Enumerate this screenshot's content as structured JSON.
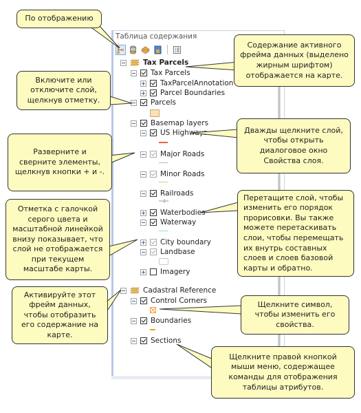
{
  "panel": {
    "title": "Таблица содержания",
    "toolbar": [
      {
        "icon": "list-by-drawing-order-icon",
        "active": true
      },
      {
        "icon": "list-by-source-icon",
        "active": false
      },
      {
        "icon": "list-by-visibility-icon",
        "active": false
      },
      {
        "icon": "list-by-selection-icon",
        "active": false
      },
      {
        "icon": "options-icon",
        "active": false
      }
    ]
  },
  "tree": {
    "tax_parcels_frame": "Tax Parcels",
    "tax_parcels_group": "Tax Parcels",
    "tax_parcel_annotation": "TaxParcelAnnotation",
    "parcel_boundaries": "Parcel Boundaries",
    "parcels": "Parcels",
    "basemap_layers": "Basemap layers",
    "us_highways": "US Highways",
    "major_roads": "Major Roads",
    "minor_roads": "Minor Roads",
    "railroads": "Railroads",
    "waterbodies": "Waterbodies",
    "waterway": "Waterway",
    "city_boundary": "City boundary",
    "landbase": "Landbase",
    "imagery": "Imagery",
    "cadastral_frame": "Cadastral Reference",
    "control_corners": "Control Corners",
    "boundaries": "Boundaries",
    "sections": "Sections"
  },
  "symbols": {
    "parcels_fill": "#fbe2b5",
    "us_highways_line": "#e8643c",
    "major_roads_line": "#b8b8b8",
    "minor_roads_line": "#e0c080",
    "railroads_line": "#999999",
    "waterway_line": "#9ad0ec",
    "control_corners_marker": "#f0a040",
    "boundaries_line": "#f0a020"
  },
  "callouts": {
    "by_drawing_order": "По отображению",
    "active_frame": "Содержание активного фрейма данных (выделено жирным шрифтом) отображается на карте.",
    "toggle_layer": "Включите или отключите слой, щелкнув отметку.",
    "layer_properties": "Дважды щелкните слой, чтобы открыть диалоговое окно Свойства слоя.",
    "expand_collapse": "Разверните и сверните элементы, щелкнув кнопки + и -.",
    "drag_layer": "Перетащите слой, чтобы изменить его порядок прорисовки. Вы также можете перетаскивать слои, чтобы перемещать их внутрь составных слоев и слоев базовой карты и обратно.",
    "grey_check": "Отметка с галочкой серого цвета и масштабной линейкой внизу показывает, что слой не отображается при текущем масштабе карты.",
    "activate_frame": "Активируйте этот фрейм данных, чтобы отобразить его содержание на карте.",
    "click_symbol": "Щелкните символ, чтобы изменить его свойства.",
    "right_click": "Щелкните правой кнопкой мыши меню, содержащее команды для отображения таблицы атрибутов."
  },
  "colors": {
    "callout_fill": "#fdfbc0",
    "callout_border": "#333333",
    "panel_border": "#b8c9e4"
  }
}
